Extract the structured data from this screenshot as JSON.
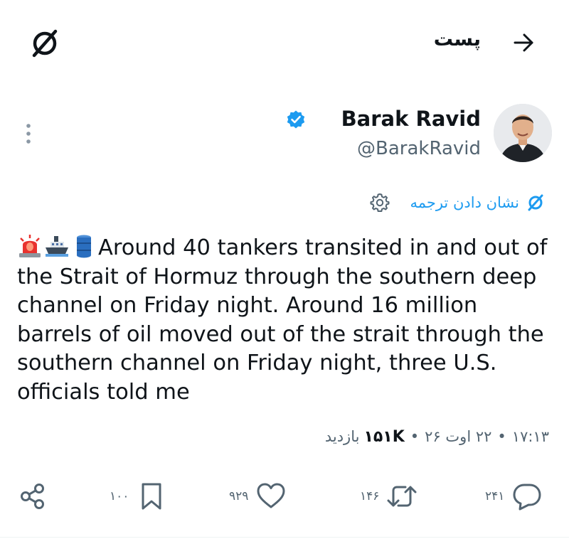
{
  "header": {
    "title": "پست",
    "back_icon": "arrow-right-icon",
    "brand_icon": "slashed-circle-logo-icon"
  },
  "author": {
    "name": "Barak Ravid",
    "handle": "@BarakRavid",
    "verified": true,
    "badge_color": "#1d9bf0",
    "avatar": "avatar-photo"
  },
  "translate": {
    "label": "نشان دادن ترجمه",
    "settings_icon": "gear-icon",
    "color": "#1d9bf0"
  },
  "tweet": {
    "emojis": [
      "rotating-light-emoji",
      "ship-emoji",
      "oil-drum-emoji"
    ],
    "text": "Around 40 tankers transited in and out of the Strait of Hormuz through the southern deep channel on Friday night. Around 16 million barrels of oil moved out of the strait through the southern channel on Friday night, three U.S. officials told me"
  },
  "meta": {
    "time": "۱۷:۱۳",
    "date": "۲۲ اوت ۲۶",
    "views_count": "۱۵۱K",
    "views_label": "بازدید"
  },
  "actions": {
    "replies": "۲۴۱",
    "reposts": "۱۴۶",
    "likes": "۹۲۹",
    "bookmarks": "۱۰۰"
  }
}
